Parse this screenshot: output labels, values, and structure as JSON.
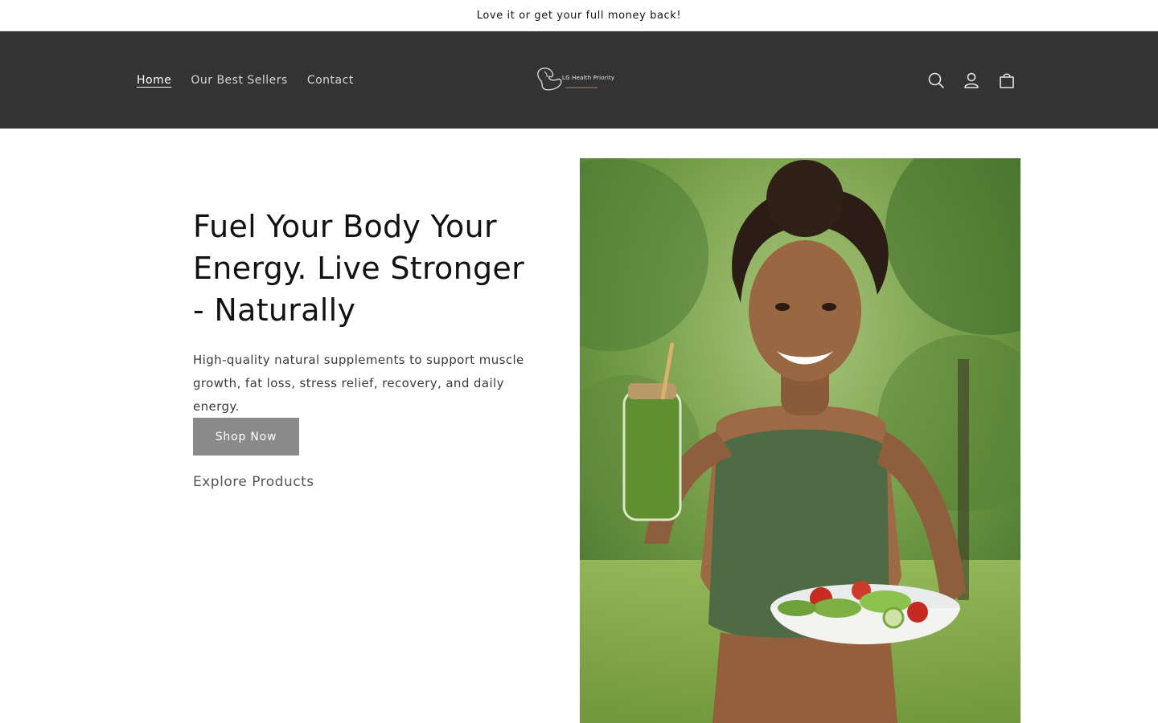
{
  "announcement": {
    "text": "Love it or get your full money back!"
  },
  "header": {
    "nav": [
      {
        "label": "Home",
        "active": true
      },
      {
        "label": "Our Best Sellers",
        "active": false
      },
      {
        "label": "Contact",
        "active": false
      }
    ],
    "logo_text": "LG Health Priority",
    "icons": [
      "search-icon",
      "account-icon",
      "cart-icon"
    ]
  },
  "hero": {
    "title": "Fuel Your Body Your Energy. Live Stronger - Naturally",
    "subtitle": "High-quality natural supplements to support muscle growth, fat loss, stress relief, recovery, and daily energy.",
    "primary_button": "Shop Now",
    "secondary_link": "Explore Products"
  },
  "colors": {
    "header_bg": "#333333",
    "button_bg": "#8a8a8a",
    "page_bg": "#ffffff"
  }
}
